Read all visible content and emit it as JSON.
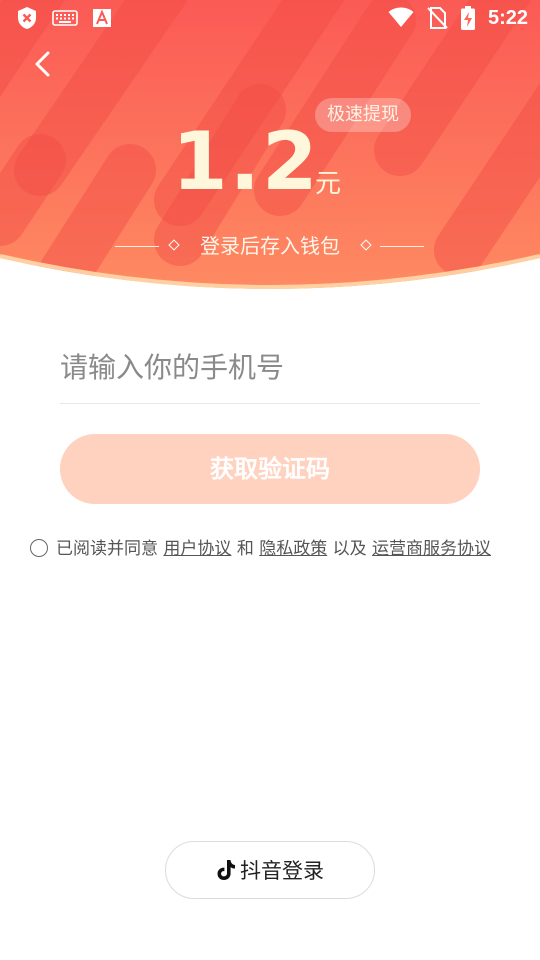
{
  "status_bar": {
    "time": "5:22",
    "icons": [
      "shield-x-icon",
      "keyboard-icon",
      "font-a-icon",
      "wifi-icon",
      "no-sim-icon",
      "battery-charging-icon"
    ]
  },
  "header": {
    "back_icon": "chevron-left-icon",
    "badge": "极速提现",
    "amount": "1.2",
    "unit": "元",
    "subtitle": "登录后存入钱包"
  },
  "form": {
    "phone_placeholder": "请输入你的手机号",
    "phone_value": "",
    "get_code_label": "获取验证码"
  },
  "agreement": {
    "checked": false,
    "prefix": "已阅读并同意",
    "user_agreement": "用户协议",
    "and": "和",
    "privacy_policy": "隐私政策",
    "also": "以及",
    "carrier_agreement": "运营商服务协议"
  },
  "douyin_login": {
    "label": "抖音登录",
    "icon": "douyin-icon"
  },
  "colors": {
    "header_top": "#fb5f55",
    "header_bottom": "#fe8a62",
    "amount_text": "#fff7dc",
    "button_disabled": "#ffd2c0",
    "curve_edge": "#ffd8a8"
  }
}
